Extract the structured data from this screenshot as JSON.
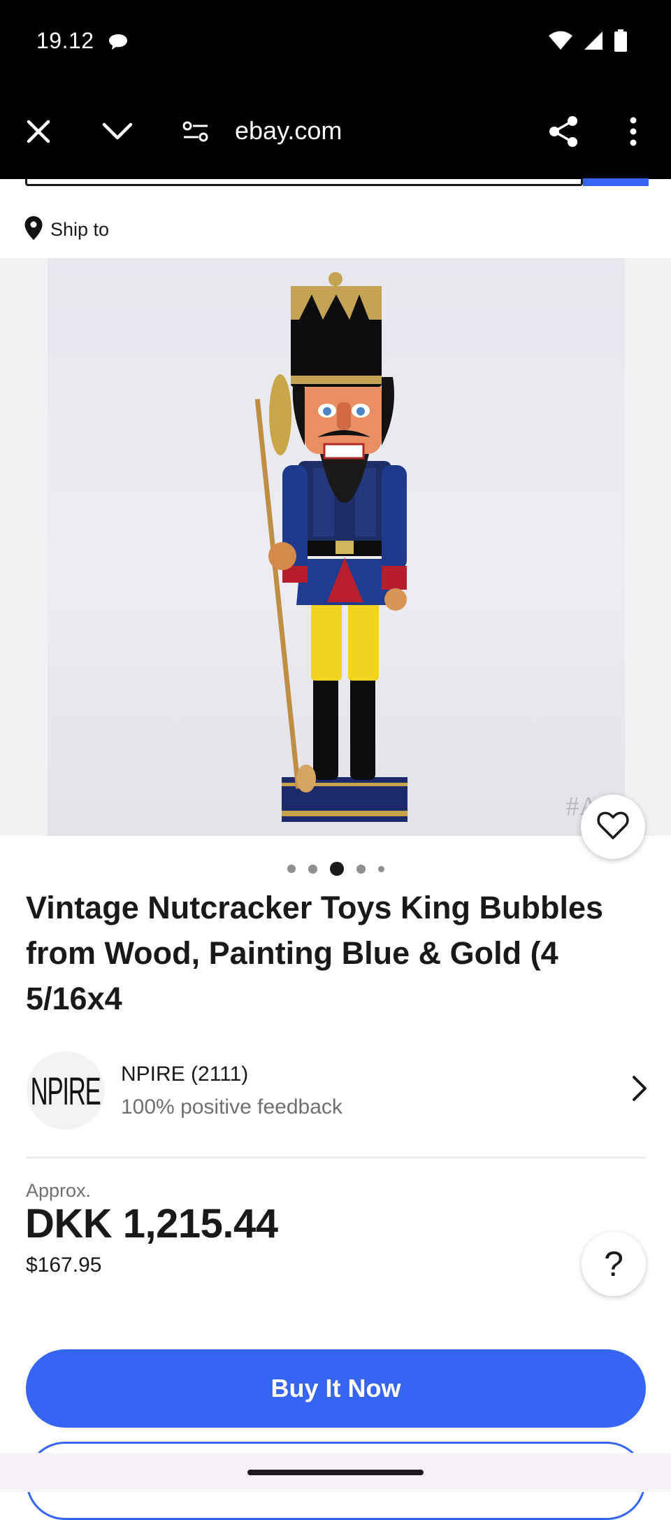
{
  "status_bar": {
    "time": "19.12"
  },
  "browser": {
    "url": "ebay.com"
  },
  "location": {
    "ship_label": "Ship to"
  },
  "gallery": {
    "watermark": "#A29",
    "dot_count": 5,
    "active_index": 2
  },
  "listing": {
    "title": "Vintage Nutcracker Toys King Bubbles from Wood, Painting Blue & Gold (4 5/16x4"
  },
  "seller": {
    "logo_text": "NPIRE",
    "name_rating": "NPIRE (2111)",
    "feedback": "100% positive feedback"
  },
  "pricing": {
    "approx_label": "Approx.",
    "price_local": "DKK 1,215.44",
    "price_usd": "$167.95"
  },
  "actions": {
    "buy_now_label": "Buy It Now",
    "help_label": "?"
  },
  "colors": {
    "accent": "#3665f3",
    "text": "#191919",
    "muted": "#707070"
  }
}
